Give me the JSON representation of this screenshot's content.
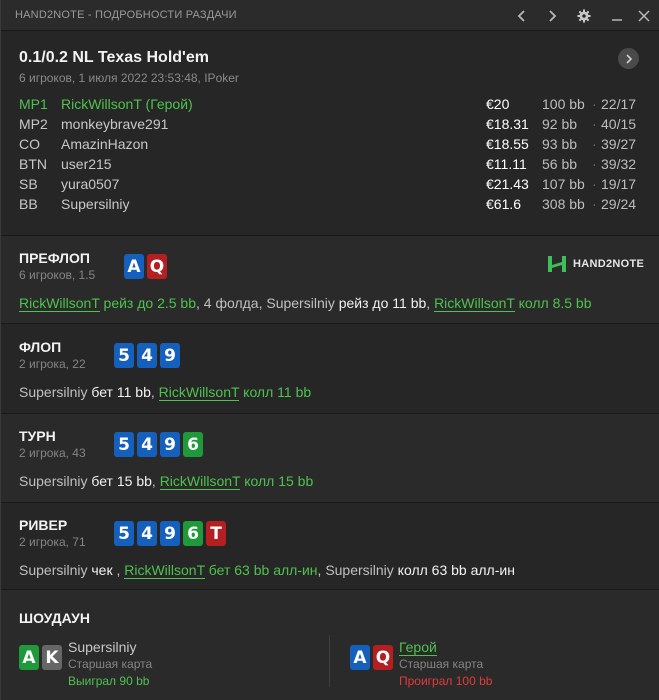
{
  "window": {
    "title": "HAND2NOTE - ПОДРОБНОСТИ РАЗДАЧИ",
    "prev_icon": "chevron-left-icon",
    "next_icon": "chevron-right-icon",
    "settings_icon": "gear-icon",
    "minimize_icon": "minimize-icon",
    "close_icon": "close-icon"
  },
  "header": {
    "game": "0.1/0.2 NL Texas Hold'em",
    "info": "6 игроков, 1 июля 2022 23:53:48, IPoker"
  },
  "players": [
    {
      "pos": "MP1",
      "name": "RickWillsonT (Герой)",
      "stack": "€20",
      "bb": "100 bb",
      "sep": "·",
      "stats": "22/17",
      "hero": true
    },
    {
      "pos": "MP2",
      "name": "monkeybrave291",
      "stack": "€18.31",
      "bb": "92 bb",
      "sep": "·",
      "stats": "40/15",
      "hero": false
    },
    {
      "pos": "CO",
      "name": "AmazinHazon",
      "stack": "€18.55",
      "bb": "93 bb",
      "sep": "·",
      "stats": "39/27",
      "hero": false
    },
    {
      "pos": "BTN",
      "name": "user215",
      "stack": "€11.11",
      "bb": "56 bb",
      "sep": "·",
      "stats": "39/32",
      "hero": false
    },
    {
      "pos": "SB",
      "name": "yura0507",
      "stack": "€21.43",
      "bb": "107 bb",
      "sep": "·",
      "stats": "19/17",
      "hero": false
    },
    {
      "pos": "BB",
      "name": "Supersilniy",
      "stack": "€61.6",
      "bb": "308 bb",
      "sep": "·",
      "stats": "29/24",
      "hero": false
    }
  ],
  "preflop": {
    "title": "ПРЕФЛОП",
    "sub": "6 игроков, 1.5",
    "cards": [
      {
        "rank": "A",
        "color": "#1560bd"
      },
      {
        "rank": "Q",
        "color": "#b41f22"
      }
    ],
    "logo_text": "HAND2NOTE",
    "actions": {
      "a1_player": "RickWillsonT",
      "a1_verb": " рейз до 2.5 bb",
      "a2_text": ", 4 фолда, ",
      "a3_player": "Supersilniy",
      "a3_verb": " рейз до 11 bb",
      "a4_sep": ", ",
      "a5_player": "RickWillsonT",
      "a5_verb": " колл 8.5 bb"
    }
  },
  "flop": {
    "title": "ФЛОП",
    "sub": "2 игрока, 22",
    "cards": [
      {
        "rank": "5",
        "color": "#1560bd"
      },
      {
        "rank": "4",
        "color": "#1560bd"
      },
      {
        "rank": "9",
        "color": "#1560bd"
      }
    ],
    "actions": {
      "a1_player": "Supersilniy",
      "a1_verb": " бет 11 bb",
      "sep": ", ",
      "a2_player": "RickWillsonT",
      "a2_verb": " колл 11 bb"
    }
  },
  "turn": {
    "title": "ТУРН",
    "sub": "2 игрока, 43",
    "cards": [
      {
        "rank": "5",
        "color": "#1560bd"
      },
      {
        "rank": "4",
        "color": "#1560bd"
      },
      {
        "rank": "9",
        "color": "#1560bd"
      },
      {
        "rank": "6",
        "color": "#1f9a3a"
      }
    ],
    "actions": {
      "a1_player": "Supersilniy",
      "a1_verb": " бет 15 bb",
      "sep": ", ",
      "a2_player": "RickWillsonT",
      "a2_verb": " колл 15 bb"
    }
  },
  "river": {
    "title": "РИВЕР",
    "sub": "2 игрока, 71",
    "cards": [
      {
        "rank": "5",
        "color": "#1560bd"
      },
      {
        "rank": "4",
        "color": "#1560bd"
      },
      {
        "rank": "9",
        "color": "#1560bd"
      },
      {
        "rank": "6",
        "color": "#1f9a3a"
      },
      {
        "rank": "T",
        "color": "#b41f22"
      }
    ],
    "actions": {
      "a1_player": "Supersilniy",
      "a1_verb": " чек ",
      "sep1": ", ",
      "a2_player": "RickWillsonT",
      "a2_verb": " бет 63 bb алл-ин",
      "sep2": ", ",
      "a3_player": "Supersilniy",
      "a3_verb": " колл 63 bb алл-ин"
    }
  },
  "showdown": {
    "title": "ШОУДАУН",
    "left": {
      "cards": [
        {
          "rank": "A",
          "color": "#1f9a3a"
        },
        {
          "rank": "K",
          "color": "#666666"
        }
      ],
      "name": "Supersilniy",
      "hand": "Старшая карта",
      "result": "Выиграл 90 bb"
    },
    "right": {
      "cards": [
        {
          "rank": "A",
          "color": "#1560bd"
        },
        {
          "rank": "Q",
          "color": "#b41f22"
        }
      ],
      "name": "Герой",
      "hand": "Старшая карта",
      "result": "Проиграл 100 bb"
    }
  }
}
